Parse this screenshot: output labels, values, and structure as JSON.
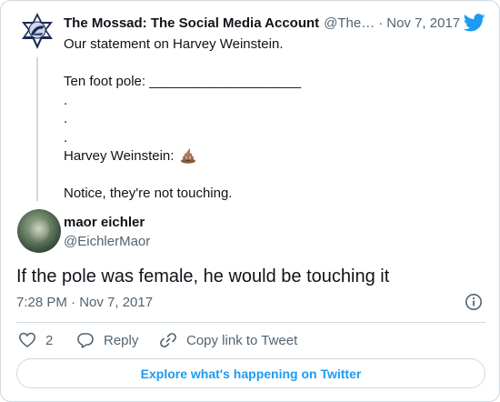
{
  "parent_tweet": {
    "display_name": "The Mossad: The Social Media Account",
    "handle": "@The…",
    "separator": "·",
    "date": "Nov 7, 2017",
    "lines": [
      "Our statement on Harvey Weinstein.",
      "",
      "Ten foot pole: ____________________",
      ".",
      ".",
      ".",
      "Harvey Weinstein: ",
      "",
      "Notice, they're not touching."
    ],
    "emoji": "poop-emoji"
  },
  "reply_tweet": {
    "display_name": "maor eichler",
    "handle": "@EichlerMaor",
    "text": "If the pole was female, he would be touching it",
    "time": "7:28 PM · Nov 7, 2017"
  },
  "actions": {
    "like_count": "2",
    "reply_label": "Reply",
    "copy_link_label": "Copy link to Tweet"
  },
  "footer": {
    "explore_label": "Explore what's happening on Twitter"
  },
  "colors": {
    "accent": "#1d9bf0",
    "secondary_text": "#536471",
    "border": "#cfd9de"
  },
  "icons": [
    "mossad-logo-avatar",
    "twitter-bird-icon",
    "info-icon",
    "heart-icon",
    "reply-icon",
    "link-icon"
  ]
}
